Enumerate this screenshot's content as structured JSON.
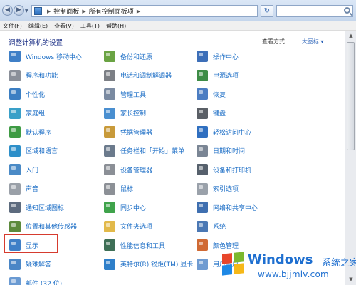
{
  "address": {
    "crumbs": [
      "控制面板",
      "所有控制面板项"
    ]
  },
  "menu": [
    "文件(F)",
    "编辑(E)",
    "查看(V)",
    "工具(T)",
    "帮助(H)"
  ],
  "content": {
    "heading": "调整计算机的设置",
    "view_by_label": "查看方式:",
    "view_by_value": "大图标 ▾"
  },
  "items": [
    {
      "label": "Windows 移动中心",
      "icon": "mobility-center-icon",
      "color": "#3f7fc7"
    },
    {
      "label": "备份和还原",
      "icon": "backup-restore-icon",
      "color": "#6aa343"
    },
    {
      "label": "操作中心",
      "icon": "action-center-flag-icon",
      "color": "#3d6fb8"
    },
    {
      "label": "程序和功能",
      "icon": "programs-features-icon",
      "color": "#8a8f99"
    },
    {
      "label": "电话和调制解调器",
      "icon": "phone-modem-icon",
      "color": "#7c7f85"
    },
    {
      "label": "电源选项",
      "icon": "power-options-icon",
      "color": "#3d8c46"
    },
    {
      "label": "个性化",
      "icon": "personalization-icon",
      "color": "#3b7ec2"
    },
    {
      "label": "管理工具",
      "icon": "admin-tools-icon",
      "color": "#7a8aa1"
    },
    {
      "label": "恢复",
      "icon": "recovery-icon",
      "color": "#4c7dc2"
    },
    {
      "label": "家庭组",
      "icon": "homegroup-icon",
      "color": "#3aa0c8"
    },
    {
      "label": "家长控制",
      "icon": "parental-controls-icon",
      "color": "#4a8fd0"
    },
    {
      "label": "键盘",
      "icon": "keyboard-icon",
      "color": "#5a5f66"
    },
    {
      "label": "默认程序",
      "icon": "default-programs-icon",
      "color": "#3e9b44"
    },
    {
      "label": "凭据管理器",
      "icon": "credential-manager-icon",
      "color": "#c89a3a"
    },
    {
      "label": "轻松访问中心",
      "icon": "ease-of-access-icon",
      "color": "#2f6fc0"
    },
    {
      "label": "区域和语言",
      "icon": "region-language-icon",
      "color": "#2d8fc9"
    },
    {
      "label": "任务栏和「开始」菜单",
      "icon": "taskbar-start-menu-icon",
      "color": "#6b7a8c"
    },
    {
      "label": "日期和时间",
      "icon": "date-time-icon",
      "color": "#7a8594"
    },
    {
      "label": "入门",
      "icon": "getting-started-icon",
      "color": "#4a8ac6"
    },
    {
      "label": "设备管理器",
      "icon": "device-manager-icon",
      "color": "#8b8f96"
    },
    {
      "label": "设备和打印机",
      "icon": "devices-printers-icon",
      "color": "#56606c"
    },
    {
      "label": "声音",
      "icon": "sound-icon",
      "color": "#9aa0a8"
    },
    {
      "label": "鼠标",
      "icon": "mouse-icon",
      "color": "#8c9096"
    },
    {
      "label": "索引选项",
      "icon": "indexing-options-icon",
      "color": "#9aa1aa"
    },
    {
      "label": "通知区域图标",
      "icon": "notification-area-icon",
      "color": "#5d6b7e"
    },
    {
      "label": "同步中心",
      "icon": "sync-center-icon",
      "color": "#3fa34b"
    },
    {
      "label": "网络和共享中心",
      "icon": "network-sharing-icon",
      "color": "#3f6fb0"
    },
    {
      "label": "位置和其他传感器",
      "icon": "location-sensors-icon",
      "color": "#5c8a3c"
    },
    {
      "label": "文件夹选项",
      "icon": "folder-options-icon",
      "color": "#e2b94a"
    },
    {
      "label": "系统",
      "icon": "system-icon",
      "color": "#4b78b4"
    },
    {
      "label": "显示",
      "icon": "display-icon",
      "color": "#3f7fc7"
    },
    {
      "label": "性能信息和工具",
      "icon": "performance-icon",
      "color": "#3e6f56"
    },
    {
      "label": "颜色管理",
      "icon": "color-management-icon",
      "color": "#d06a34"
    },
    {
      "label": "疑难解答",
      "icon": "troubleshooting-icon",
      "color": "#4a86c6"
    },
    {
      "label": "英特尔(R) 锐炬(TM) 显卡",
      "icon": "intel-graphics-icon",
      "color": "#2f7fc9"
    },
    {
      "label": "用户帐户",
      "icon": "user-accounts-icon",
      "color": "#6f9bd1"
    },
    {
      "label": "邮件 (32 位)",
      "icon": "mail-icon",
      "color": "#6a9ad2"
    }
  ],
  "watermark": {
    "title": "Windows",
    "subtitle": "系统之家",
    "url": "www.bjjmlv.com",
    "logo_colors": [
      "#e8462b",
      "#7cb82f",
      "#1e88e5",
      "#f6b818"
    ]
  }
}
